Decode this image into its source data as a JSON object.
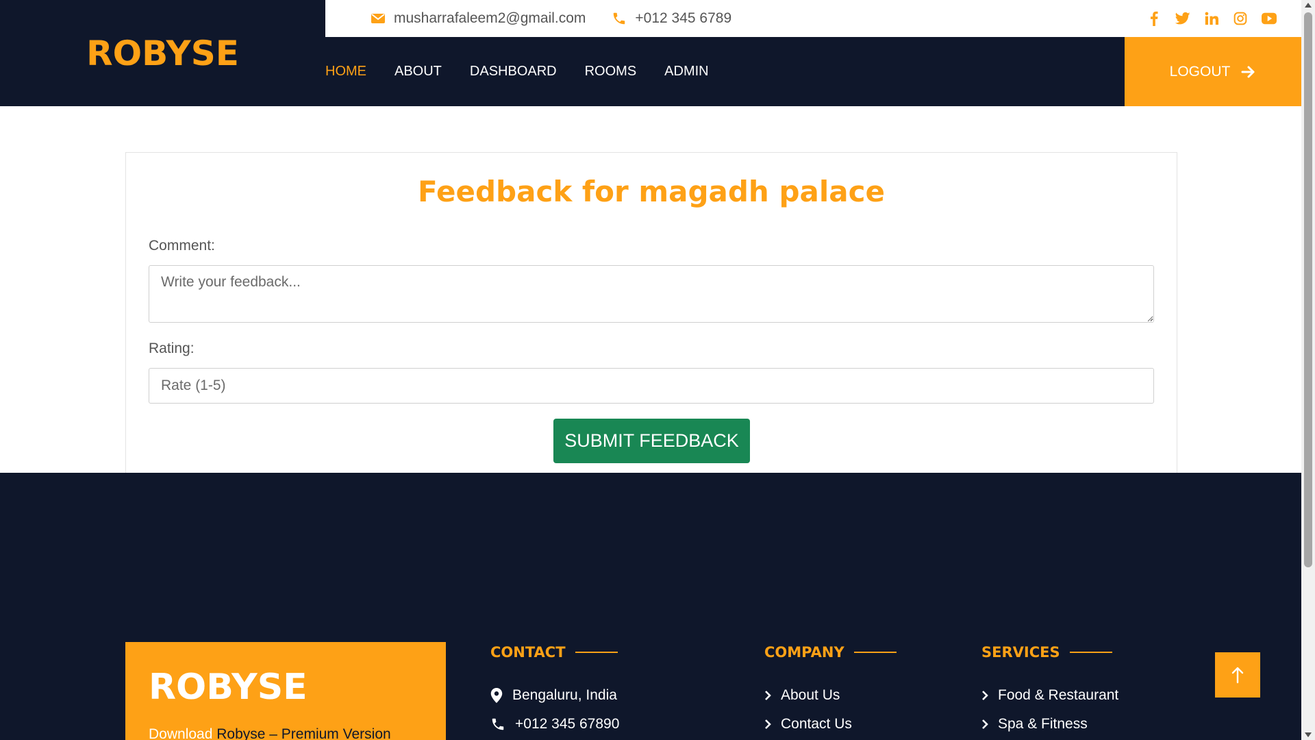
{
  "header": {
    "brand": "ROBYSE",
    "email": "musharrafaleem2@gmail.com",
    "phone": "+012 345 6789",
    "socials": [
      "facebook-icon",
      "twitter-icon",
      "linkedin-icon",
      "instagram-icon",
      "youtube-icon"
    ],
    "nav": [
      {
        "label": "HOME",
        "active": true
      },
      {
        "label": "ABOUT",
        "active": false
      },
      {
        "label": "DASHBOARD",
        "active": false
      },
      {
        "label": "ROOMS",
        "active": false
      },
      {
        "label": "ADMIN",
        "active": false
      }
    ],
    "logout_label": "LOGOUT"
  },
  "form": {
    "title": "Feedback for magadh palace",
    "comment_label": "Comment:",
    "comment_placeholder": "Write your feedback...",
    "rating_label": "Rating:",
    "rating_placeholder": "Rate (1-5)",
    "submit_label": "SUBMIT FEEDBACK"
  },
  "footer": {
    "brand": "ROBYSE",
    "download_link": "Download",
    "download_text": " Robyse – Premium Version",
    "contact": {
      "heading": "CONTACT",
      "items": [
        "Bengaluru, India",
        "+012 345 67890"
      ]
    },
    "company": {
      "heading": "COMPANY",
      "items": [
        "About Us",
        "Contact Us"
      ]
    },
    "services": {
      "heading": "SERVICES",
      "items": [
        "Food & Restaurant",
        "Spa & Fitness"
      ]
    }
  },
  "colors": {
    "accent": "#fea116",
    "dark": "#0f172b",
    "submit": "#198754"
  }
}
